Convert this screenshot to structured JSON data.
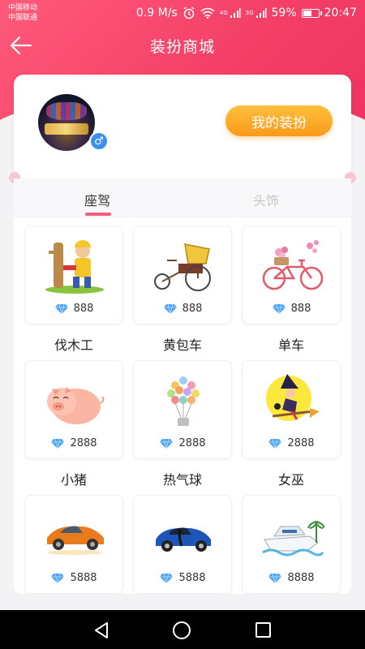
{
  "status": {
    "carrier1": "中国移动",
    "carrier2": "中国联通",
    "speed": "0.9 M/s",
    "net1": "4G",
    "net2": "3G",
    "battery": "59%",
    "battery_level": 0.59,
    "time": "20:47"
  },
  "nav": {
    "title": "装扮商城"
  },
  "profile": {
    "gender_symbol": "♂",
    "my_outfit_label": "我的装扮"
  },
  "tabs": [
    {
      "label": "座驾",
      "active": true
    },
    {
      "label": "头饰",
      "active": false
    }
  ],
  "items": [
    {
      "name": "伐木工",
      "price": "888"
    },
    {
      "name": "黄包车",
      "price": "888"
    },
    {
      "name": "单车",
      "price": "888"
    },
    {
      "name": "小猪",
      "price": "2888"
    },
    {
      "name": "热气球",
      "price": "2888"
    },
    {
      "name": "女巫",
      "price": "2888"
    },
    {
      "name": "",
      "price": "5888"
    },
    {
      "name": "",
      "price": "5888"
    },
    {
      "name": "",
      "price": "8888"
    }
  ],
  "colors": {
    "accent": "#f43f67",
    "button": "#f99a1b",
    "tab_indicator": "#f45d80",
    "diamond": "#4fa3f7"
  }
}
